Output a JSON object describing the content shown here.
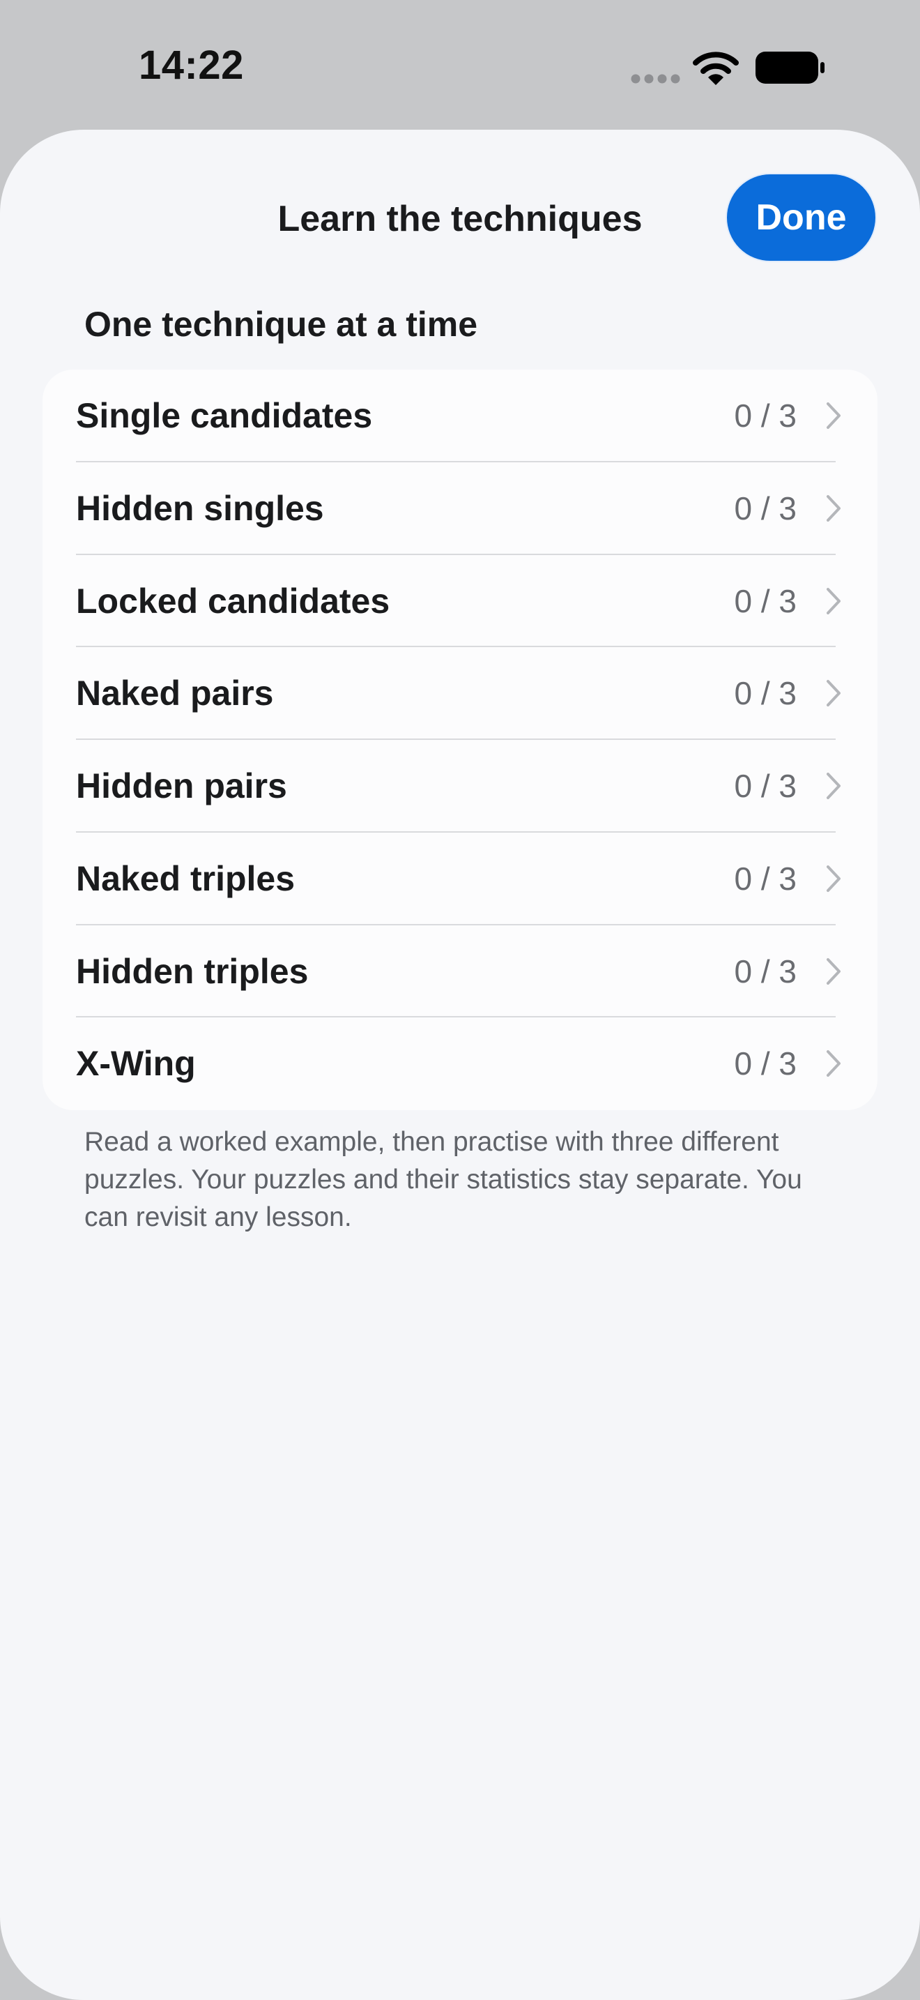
{
  "status_bar": {
    "time": "14:22",
    "icons": [
      "signal-dots-icon",
      "wifi-icon",
      "battery-icon"
    ]
  },
  "sheet": {
    "title": "Learn the techniques",
    "done_label": "Done",
    "section_header": "One technique at a time",
    "techniques": [
      {
        "name": "Single candidates",
        "progress": "0 / 3"
      },
      {
        "name": "Hidden singles",
        "progress": "0 / 3"
      },
      {
        "name": "Locked candidates",
        "progress": "0 / 3"
      },
      {
        "name": "Naked pairs",
        "progress": "0 / 3"
      },
      {
        "name": "Hidden pairs",
        "progress": "0 / 3"
      },
      {
        "name": "Naked triples",
        "progress": "0 / 3"
      },
      {
        "name": "Hidden triples",
        "progress": "0 / 3"
      },
      {
        "name": "X-Wing",
        "progress": "0 / 3"
      }
    ],
    "footnote": "Read a worked example, then practise with three different puzzles. Your puzzles and their statistics stay separate. You can revisit any lesson."
  },
  "colors": {
    "accent": "#0b6cda",
    "background": "#f5f6f9",
    "backdrop": "#c6c7c9",
    "secondary_text": "#6a6c71"
  }
}
